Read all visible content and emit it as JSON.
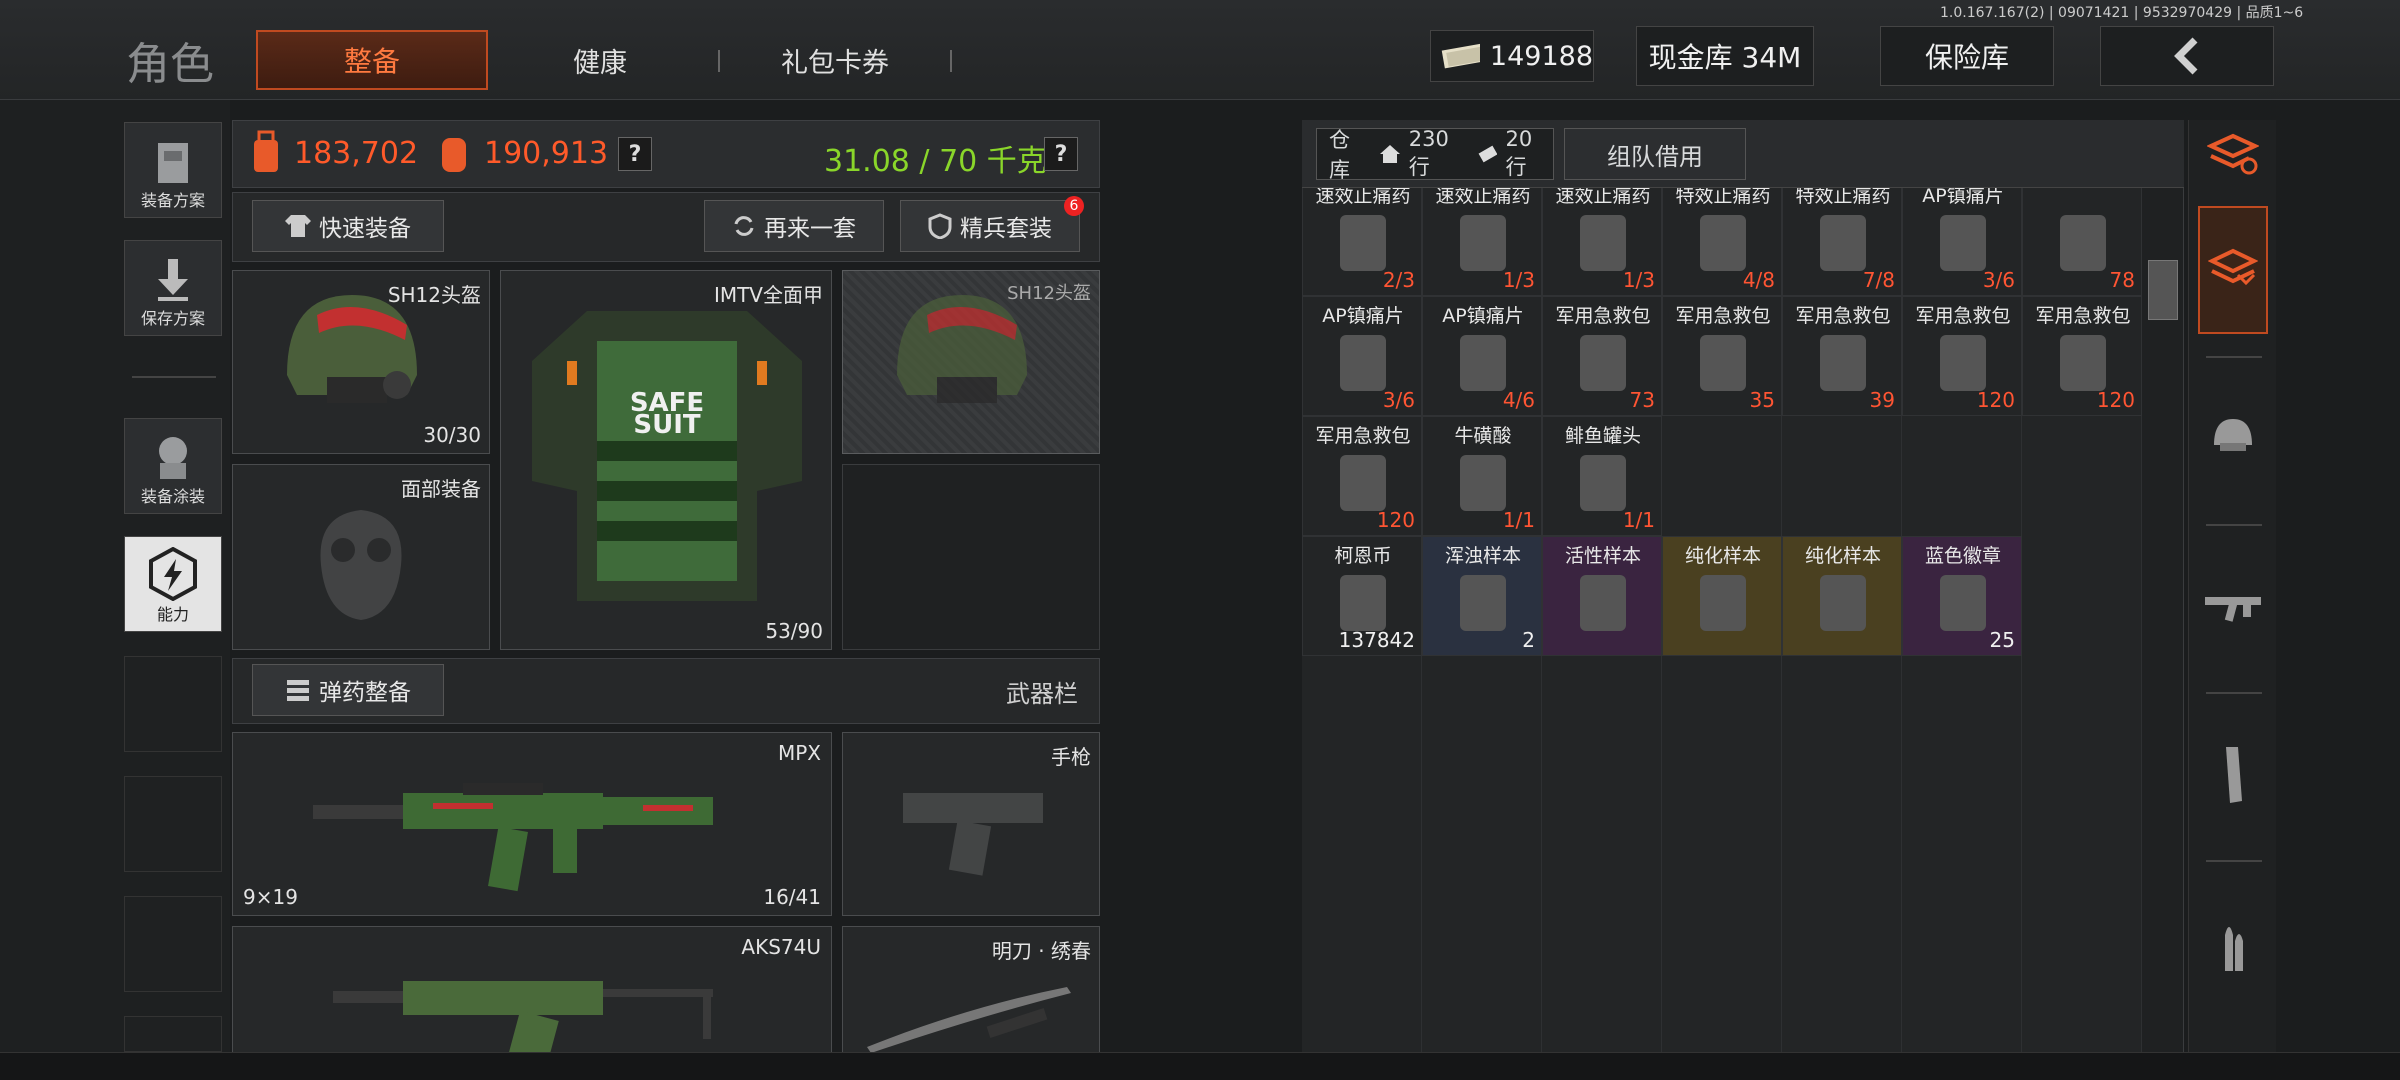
{
  "version_info": "1.0.167.167(2) | 09071421 | 9532970429 | 品质1~6",
  "header": {
    "title": "角色",
    "tabs": [
      {
        "label": "整备",
        "active": true
      },
      {
        "label": "健康",
        "active": false
      },
      {
        "label": "礼包卡券",
        "active": false
      }
    ],
    "currency_value": "149188",
    "cash_vault": "现金库 34M",
    "safe_label": "保险库"
  },
  "sidebar": {
    "loadout": "装备方案",
    "save": "保存方案",
    "paint": "装备涂装",
    "ability": "能力"
  },
  "stats": {
    "value1": "183,702",
    "value2": "190,913",
    "weight": "31.08 / 70 千克",
    "q": "?"
  },
  "actions": {
    "quick_equip": "快速装备",
    "again": "再来一套",
    "elite": "精兵套装",
    "elite_badge": "6",
    "ammo": "弹药整备",
    "weapon_bar": "武器栏"
  },
  "equipment": {
    "helmet": {
      "name": "SH12头盔",
      "durability": "30/30"
    },
    "armor": {
      "name": "IMTV全面甲",
      "durability": "53/90"
    },
    "helmet2": {
      "name": "SH12头盔"
    },
    "face": {
      "name": "面部装备"
    },
    "primary": {
      "name": "MPX",
      "ammo": "9×19",
      "count": "16/41"
    },
    "pistol": {
      "name": "手枪"
    },
    "secondary": {
      "name": "AKS74U"
    },
    "melee": {
      "name": "明刀 · 绣春"
    }
  },
  "warehouse": {
    "tab_label": "仓库",
    "rows1": "230行",
    "rows2": "20行",
    "team_borrow": "组队借用",
    "grid": [
      [
        {
          "name": "速效止痛药",
          "count": "2/3",
          "color": "red",
          "tone": ""
        },
        {
          "name": "速效止痛药",
          "count": "1/3",
          "color": "red",
          "tone": ""
        },
        {
          "name": "速效止痛药",
          "count": "1/3",
          "color": "red",
          "tone": ""
        },
        {
          "name": "特效止痛药",
          "count": "4/8",
          "color": "red",
          "tone": ""
        },
        {
          "name": "特效止痛药",
          "count": "7/8",
          "color": "red",
          "tone": ""
        },
        {
          "name": "AP镇痛片",
          "count": "3/6",
          "color": "red",
          "tone": ""
        },
        {
          "name": "",
          "count": "78",
          "color": "red",
          "tone": ""
        }
      ],
      [
        {
          "name": "AP镇痛片",
          "count": "3/6",
          "color": "red",
          "tone": ""
        },
        {
          "name": "AP镇痛片",
          "count": "4/6",
          "color": "red",
          "tone": ""
        },
        {
          "name": "军用急救包",
          "count": "73",
          "color": "red",
          "tone": ""
        },
        {
          "name": "军用急救包",
          "count": "35",
          "color": "red",
          "tone": ""
        },
        {
          "name": "军用急救包",
          "count": "39",
          "color": "red",
          "tone": ""
        },
        {
          "name": "军用急救包",
          "count": "120",
          "color": "red",
          "tone": ""
        },
        {
          "name": "军用急救包",
          "count": "120",
          "color": "red",
          "tone": ""
        }
      ],
      [
        {
          "name": "军用急救包",
          "count": "120",
          "color": "red",
          "tone": ""
        },
        {
          "name": "牛磺酸",
          "count": "1/1",
          "color": "red",
          "tone": ""
        },
        {
          "name": "鲱鱼罐头",
          "count": "1/1",
          "color": "red",
          "tone": ""
        }
      ],
      [
        {
          "name": "柯恩币",
          "count": "137842",
          "color": "white",
          "tone": ""
        },
        {
          "name": "浑浊样本",
          "count": "2",
          "color": "white",
          "tone": "blue"
        },
        {
          "name": "活性样本",
          "count": "",
          "color": "white",
          "tone": "purple"
        },
        {
          "name": "纯化样本",
          "count": "",
          "color": "white",
          "tone": "yellow"
        },
        {
          "name": "纯化样本",
          "count": "",
          "color": "white",
          "tone": "yellow"
        },
        {
          "name": "蓝色徽章",
          "count": "25",
          "color": "white",
          "tone": "purple"
        }
      ]
    ]
  },
  "icons": [
    "loadout-icon",
    "save-icon",
    "paint-icon",
    "ability-icon",
    "back-icon",
    "vault-icon",
    "helmet-icon",
    "rifle-icon",
    "magazine-icon",
    "ammo-icon"
  ]
}
